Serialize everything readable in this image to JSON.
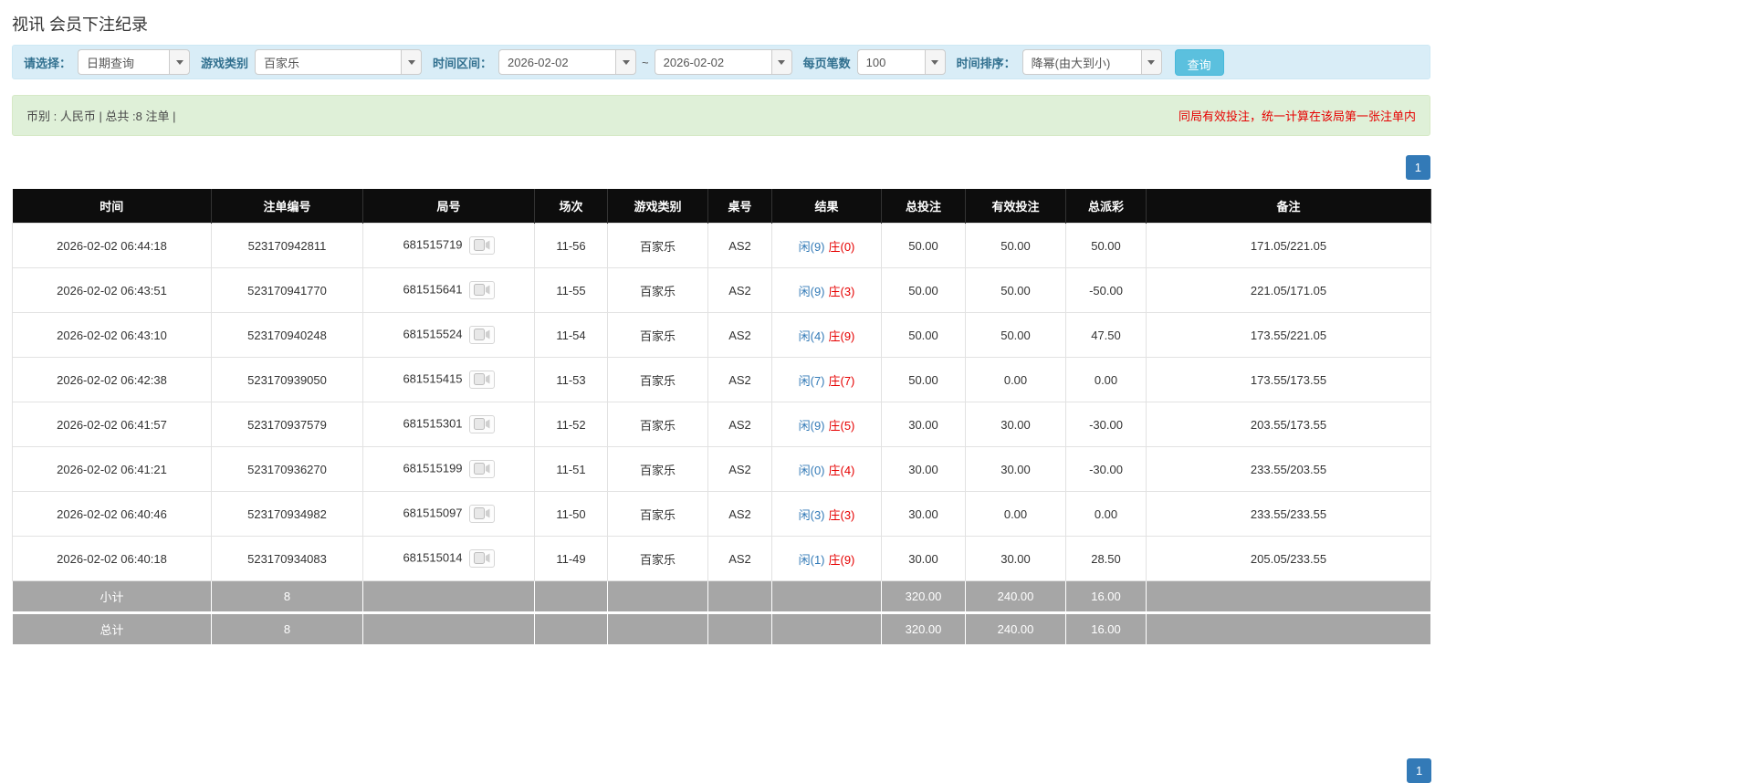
{
  "page": {
    "title": "视讯 会员下注纪录"
  },
  "filter_bar": {
    "select_label": "请选择：",
    "select_value": "日期查询",
    "game_label": "游戏类别",
    "game_value": "百家乐",
    "range_label": "时间区间：",
    "date_from": "2026-02-02",
    "range_separator": "~",
    "date_to": "2026-02-02",
    "per_page_label": "每页笔数",
    "per_page_value": "100",
    "sort_label": "时间排序：",
    "sort_value": "降幂(由大到小)",
    "search_button": "查询"
  },
  "summary_bar": {
    "info": "币别 : 人民币 | 总共 :8 注单 |",
    "notice": "同局有效投注，统一计算在该局第一张注单内"
  },
  "pagination": {
    "current_page": "1"
  },
  "colors": {
    "accent_blue": "#337ab7",
    "danger_red": "#e60000",
    "header_bg": "#0d0d0d",
    "footer_bg": "#a6a6a6",
    "filter_bg": "#d9edf7",
    "summary_bg": "#dff0d8",
    "search_button_bg": "#5bc0de"
  },
  "table": {
    "headers": {
      "time": "时间",
      "bet_no": "注单编号",
      "round_no": "局号",
      "session": "场次",
      "game_type": "游戏类别",
      "table_no": "桌号",
      "result": "结果",
      "total_bet": "总投注",
      "valid_bet": "有效投注",
      "total_payout": "总派彩",
      "remark": "备注"
    },
    "rows": [
      {
        "time": "2026-02-02 06:44:18",
        "bet_no": "523170942811",
        "round_no": "681515719",
        "session": "11-56",
        "game_type": "百家乐",
        "table_no": "AS2",
        "result_player": "闲(9)",
        "result_banker": "庄(0)",
        "total_bet": "50.00",
        "valid_bet": "50.00",
        "total_payout": "50.00",
        "remark": "171.05/221.05"
      },
      {
        "time": "2026-02-02 06:43:51",
        "bet_no": "523170941770",
        "round_no": "681515641",
        "session": "11-55",
        "game_type": "百家乐",
        "table_no": "AS2",
        "result_player": "闲(9)",
        "result_banker": "庄(3)",
        "total_bet": "50.00",
        "valid_bet": "50.00",
        "total_payout": "-50.00",
        "remark": "221.05/171.05"
      },
      {
        "time": "2026-02-02 06:43:10",
        "bet_no": "523170940248",
        "round_no": "681515524",
        "session": "11-54",
        "game_type": "百家乐",
        "table_no": "AS2",
        "result_player": "闲(4)",
        "result_banker": "庄(9)",
        "total_bet": "50.00",
        "valid_bet": "50.00",
        "total_payout": "47.50",
        "remark": "173.55/221.05"
      },
      {
        "time": "2026-02-02 06:42:38",
        "bet_no": "523170939050",
        "round_no": "681515415",
        "session": "11-53",
        "game_type": "百家乐",
        "table_no": "AS2",
        "result_player": "闲(7)",
        "result_banker": "庄(7)",
        "total_bet": "50.00",
        "valid_bet": "0.00",
        "total_payout": "0.00",
        "remark": "173.55/173.55"
      },
      {
        "time": "2026-02-02 06:41:57",
        "bet_no": "523170937579",
        "round_no": "681515301",
        "session": "11-52",
        "game_type": "百家乐",
        "table_no": "AS2",
        "result_player": "闲(9)",
        "result_banker": "庄(5)",
        "total_bet": "30.00",
        "valid_bet": "30.00",
        "total_payout": "-30.00",
        "remark": "203.55/173.55"
      },
      {
        "time": "2026-02-02 06:41:21",
        "bet_no": "523170936270",
        "round_no": "681515199",
        "session": "11-51",
        "game_type": "百家乐",
        "table_no": "AS2",
        "result_player": "闲(0)",
        "result_banker": "庄(4)",
        "total_bet": "30.00",
        "valid_bet": "30.00",
        "total_payout": "-30.00",
        "remark": "233.55/203.55"
      },
      {
        "time": "2026-02-02 06:40:46",
        "bet_no": "523170934982",
        "round_no": "681515097",
        "session": "11-50",
        "game_type": "百家乐",
        "table_no": "AS2",
        "result_player": "闲(3)",
        "result_banker": "庄(3)",
        "total_bet": "30.00",
        "valid_bet": "0.00",
        "total_payout": "0.00",
        "remark": "233.55/233.55"
      },
      {
        "time": "2026-02-02 06:40:18",
        "bet_no": "523170934083",
        "round_no": "681515014",
        "session": "11-49",
        "game_type": "百家乐",
        "table_no": "AS2",
        "result_player": "闲(1)",
        "result_banker": "庄(9)",
        "total_bet": "30.00",
        "valid_bet": "30.00",
        "total_payout": "28.50",
        "remark": "205.05/233.55"
      }
    ],
    "subtotal_row": {
      "label": "小计",
      "count": "8",
      "total_bet": "320.00",
      "valid_bet": "240.00",
      "total_payout": "16.00"
    },
    "total_row": {
      "label": "总计",
      "count": "8",
      "total_bet": "320.00",
      "valid_bet": "240.00",
      "total_payout": "16.00"
    }
  }
}
